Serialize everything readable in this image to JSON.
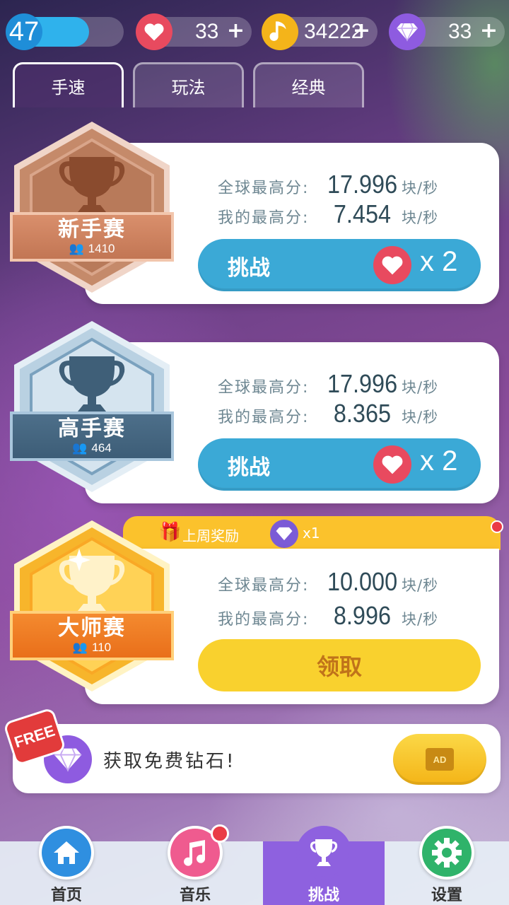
{
  "topbar": {
    "level": "47",
    "level_progress": 0.7,
    "hearts": "33",
    "coins": "34222",
    "gems": "33",
    "plus": "+"
  },
  "tabs": [
    {
      "label": "手速",
      "active": true
    },
    {
      "label": "玩法",
      "active": false
    },
    {
      "label": "经典",
      "active": false
    }
  ],
  "stat_labels": {
    "global": "全球最高分:",
    "mine": "我的最高分:",
    "unit": "块/秒"
  },
  "contests": [
    {
      "name": "新手赛",
      "players": "1410",
      "global_best": "17.996",
      "my_best": "7.454",
      "button": "挑战",
      "cost": "x 2"
    },
    {
      "name": "高手赛",
      "players": "464",
      "global_best": "17.996",
      "my_best": "8.365",
      "button": "挑战",
      "cost": "x 2"
    },
    {
      "name": "大师赛",
      "players": "110",
      "global_best": "10.000",
      "my_best": "8.996",
      "button": "领取",
      "reward_title": "上周奖励",
      "reward_qty": "x1"
    }
  ],
  "free": {
    "badge": "FREE",
    "text": "获取免费钻石!",
    "ad": "AD"
  },
  "nav": [
    {
      "label": "首页",
      "icon": "home-icon"
    },
    {
      "label": "音乐",
      "icon": "music-icon"
    },
    {
      "label": "挑战",
      "icon": "trophy-icon",
      "active": true
    },
    {
      "label": "设置",
      "icon": "gear-icon"
    }
  ],
  "colors": {
    "bronze": "#c58a6a",
    "silver": "#8fb4cf",
    "gold": "#f7b52b",
    "blue_button": "#3ba9d6",
    "yellow_button": "#f9d12e"
  }
}
